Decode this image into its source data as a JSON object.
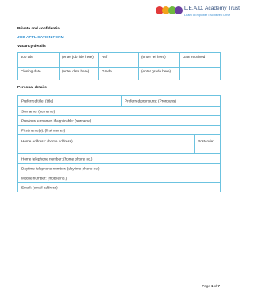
{
  "logo": {
    "name": "L.E.A.D. Academy Trust",
    "tagline": "Learn • Empower • Achieve • Drive",
    "dot_colors": [
      "#e23a3a",
      "#f2a31b",
      "#6fb83f",
      "#6b3fa0"
    ]
  },
  "header": {
    "confidential": "Private and confidential",
    "form_title": "JOB APPLICATION FORM"
  },
  "vacancy": {
    "heading": "Vacancy details",
    "job_title_label": "Job title",
    "job_title_value": "(enter job title here)",
    "ref_label": "Ref",
    "ref_value": "(enter ref here)",
    "date_received_label": "Date received",
    "closing_date_label": "Closing date",
    "closing_date_value": "(enter date here)",
    "grade_label": "Grade",
    "grade_value": "(enter grade here)"
  },
  "personal": {
    "heading": "Personal details",
    "preferred_title": "Preferred title: (title)",
    "preferred_pronouns": "Preferred pronouns: (Pronouns)",
    "surname": "Surname: (surname)",
    "previous_surnames": "Previous surnames if applicable: (surname)",
    "first_names": "First name(s): (first names)",
    "home_address": "Home address: (home address)",
    "postcode": "Postcode:",
    "home_phone": "Home telephone number:     (home phone no.)",
    "daytime_phone": "Daytime telephone number: (daytime phone no.)",
    "mobile": "Mobile number: (mobile no.)",
    "email": "Email: (email address)"
  },
  "footer": {
    "page_word": "Page",
    "current": "1",
    "of_word": "of",
    "total": "7"
  }
}
